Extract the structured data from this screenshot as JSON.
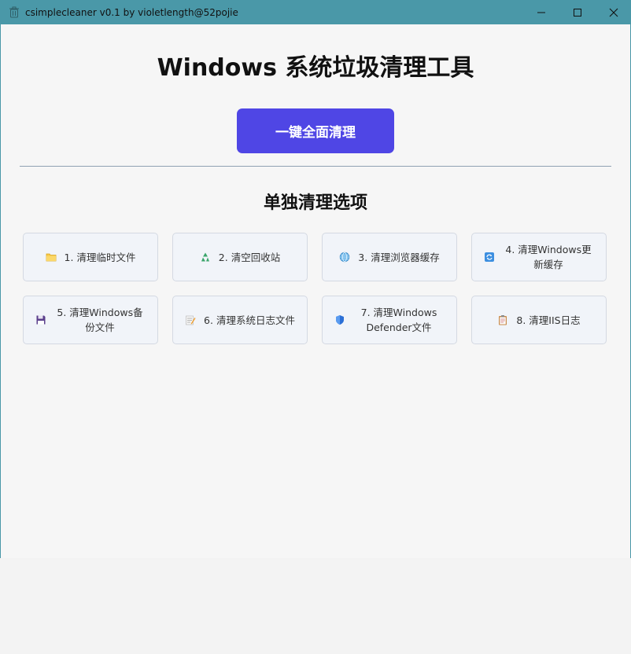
{
  "window": {
    "title": "csimplecleaner v0.1 by violetlength@52pojie"
  },
  "main": {
    "title": "Windows 系统垃圾清理工具",
    "clean_all_label": "一键全面清理",
    "section_title": "单独清理选项"
  },
  "options": [
    {
      "label": "1. 清理临时文件",
      "icon": "folder-icon"
    },
    {
      "label": "2. 清空回收站",
      "icon": "recycle-icon"
    },
    {
      "label": "3. 清理浏览器缓存",
      "icon": "globe-icon"
    },
    {
      "label": "4. 清理Windows更新缓存",
      "icon": "update-icon"
    },
    {
      "label": "5. 清理Windows备份文件",
      "icon": "floppy-disk-icon"
    },
    {
      "label": "6. 清理系统日志文件",
      "icon": "memo-icon"
    },
    {
      "label": "7. 清理Windows Defender文件",
      "icon": "shield-icon"
    },
    {
      "label": "8. 清理IIS日志",
      "icon": "clipboard-icon"
    }
  ],
  "colors": {
    "titlebar": "#4a98a8",
    "primary_button": "#4f46e5",
    "option_background": "#f1f4f9"
  }
}
